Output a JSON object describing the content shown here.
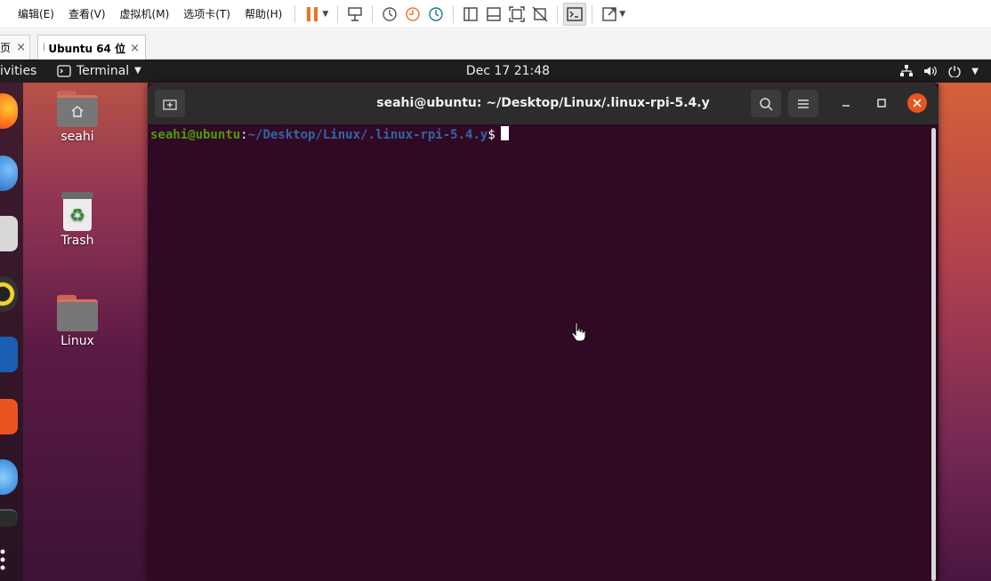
{
  "vmware": {
    "menus": [
      "编辑(E)",
      "查看(V)",
      "虚拟机(M)",
      "选项卡(T)",
      "帮助(H)"
    ],
    "tabs": {
      "home_label": "页",
      "active_label": "Ubuntu 64 位",
      "close": "×"
    }
  },
  "topbar": {
    "activities": "ivities",
    "app_menu_label": "Terminal",
    "clock": "Dec 17  21:48"
  },
  "desktop": {
    "icons": [
      {
        "label": "seahi"
      },
      {
        "label": "Trash"
      },
      {
        "label": "Linux"
      }
    ]
  },
  "terminal": {
    "title": "seahi@ubuntu: ~/Desktop/Linux/.linux-rpi-5.4.y",
    "prompt_user": "seahi@ubuntu",
    "prompt_colon": ":",
    "prompt_path": "~/Desktop/Linux/.linux-rpi-5.4.y",
    "prompt_symbol": "$"
  },
  "colors": {
    "terminal_bg": "#300a24",
    "ubuntu_orange": "#e95420",
    "prompt_user": "#4e9a06",
    "prompt_path": "#3465a4",
    "pause_icon": "#e8742a"
  },
  "icons": [
    "pause-icon",
    "send-ctrl-alt-del-icon",
    "snapshot-icon",
    "revert-snapshot-icon",
    "snapshot-manager-icon",
    "console-view-icon",
    "fullscreen-icon",
    "search-icon",
    "hamburger-menu-icon",
    "new-tab-icon",
    "home-icon",
    "recycle-icon",
    "network-icon",
    "volume-icon",
    "power-icon"
  ]
}
